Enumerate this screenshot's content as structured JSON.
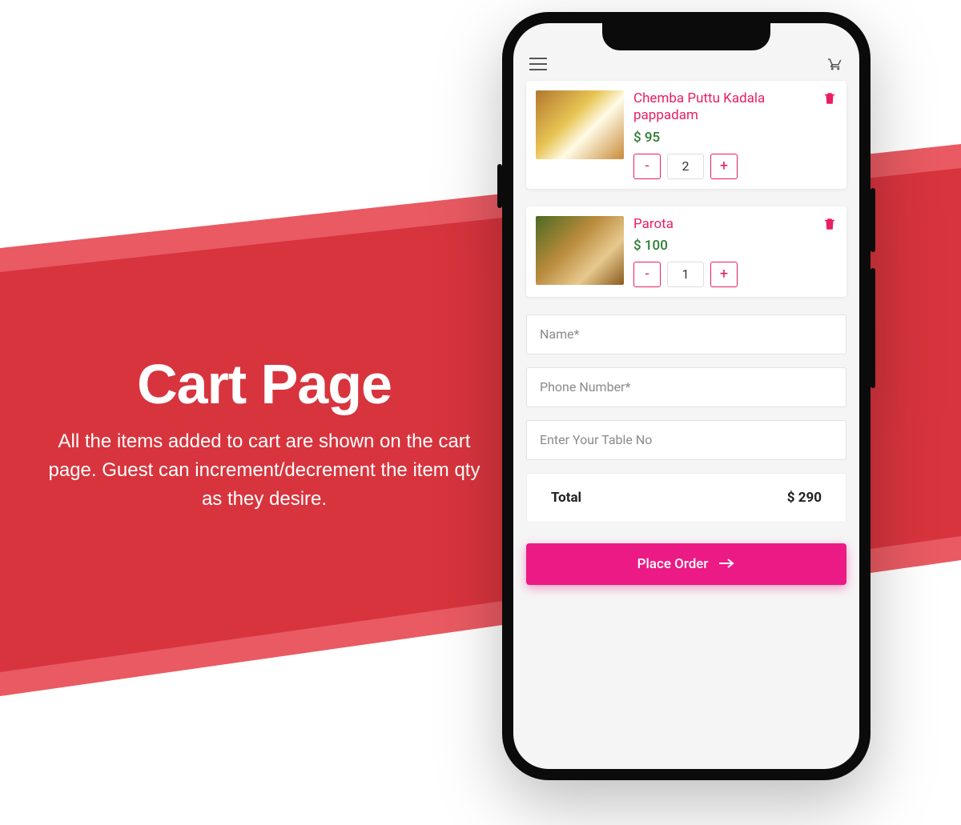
{
  "promo": {
    "title": "Cart Page",
    "description": "All the items added to cart are shown on the cart page. Guest can increment/decrement the item qty as they desire."
  },
  "cart": {
    "items": [
      {
        "name": "Chemba Puttu Kadala pappadam",
        "price": "$ 95",
        "qty": "2"
      },
      {
        "name": "Parota",
        "price": "$ 100",
        "qty": "1"
      }
    ],
    "minus_label": "-",
    "plus_label": "+"
  },
  "form": {
    "name_placeholder": "Name*",
    "phone_placeholder": "Phone Number*",
    "table_placeholder": "Enter Your Table No"
  },
  "summary": {
    "total_label": "Total",
    "total_value": "$ 290"
  },
  "actions": {
    "place_order": "Place Order"
  },
  "colors": {
    "accent_pink": "#e91e63",
    "cta_pink": "#ec1a84",
    "ribbon_red": "#d8343d",
    "ribbon_red_light": "#e95a62",
    "price_green": "#2e7d32"
  }
}
